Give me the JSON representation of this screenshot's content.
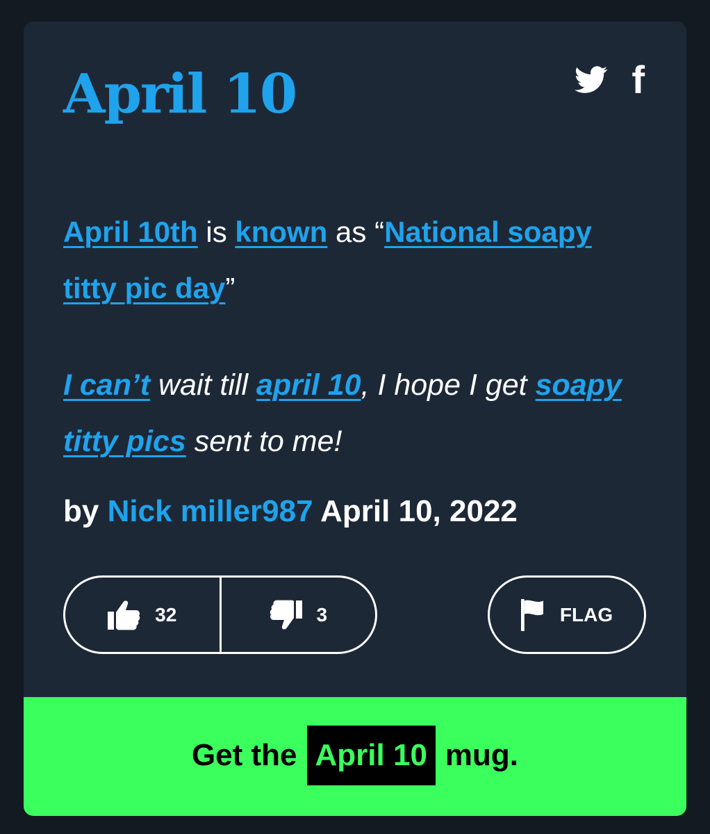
{
  "definition": {
    "title": "April 10",
    "meaning": [
      {
        "type": "link",
        "text": "April 10th"
      },
      {
        "type": "text",
        "text": " is "
      },
      {
        "type": "link",
        "text": "known"
      },
      {
        "type": "text",
        "text": " as “"
      },
      {
        "type": "link",
        "text": "National soapy titty pic day"
      },
      {
        "type": "text",
        "text": "”"
      }
    ],
    "example": [
      {
        "type": "link",
        "text": "I can’t"
      },
      {
        "type": "text",
        "text": " wait till "
      },
      {
        "type": "link",
        "text": "april 10"
      },
      {
        "type": "text",
        "text": ", I hope I get "
      },
      {
        "type": "link",
        "text": "soapy titty pics"
      },
      {
        "type": "text",
        "text": " sent to me!"
      }
    ],
    "byline": {
      "prefix": "by",
      "author": "Nick miller987",
      "date": "April 10, 2022"
    }
  },
  "share": {
    "twitter_icon": "twitter-icon",
    "facebook_icon": "facebook-icon",
    "facebook_glyph": "f"
  },
  "votes": {
    "up_count": "32",
    "down_count": "3",
    "up_icon": "thumbs-up-icon",
    "down_icon": "thumbs-down-icon"
  },
  "flag": {
    "label": "FLAG",
    "icon": "flag-icon"
  },
  "mug": {
    "prefix": "Get the",
    "term": "April 10",
    "suffix": "mug."
  },
  "colors": {
    "background": "#131a22",
    "card": "#1d2837",
    "accent_blue": "#1fa3ec",
    "mug_green": "#3bff5c",
    "text": "#ffffff"
  }
}
